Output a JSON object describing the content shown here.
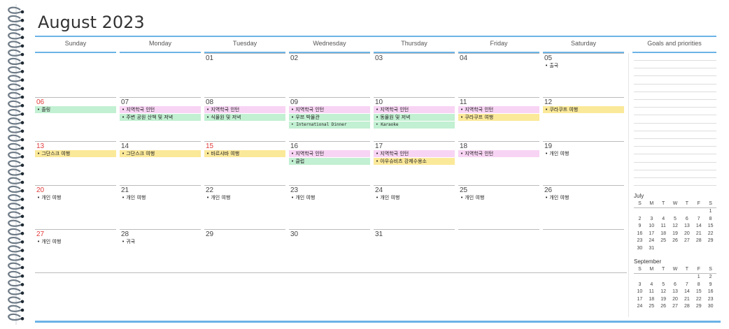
{
  "title": "August 2023",
  "goals_title": "Goals and priorities",
  "colors": {
    "accent": "#6bb3e6",
    "pink": "#f8d4f4",
    "green": "#c2f0d2",
    "yellow": "#fbe99a",
    "weekend_red": "#e23b3b"
  },
  "weekdays": [
    "Sunday",
    "Monday",
    "Tuesday",
    "Wednesday",
    "Thursday",
    "Friday",
    "Saturday"
  ],
  "weeks": [
    [
      {
        "num": "",
        "events": []
      },
      {
        "num": "",
        "events": []
      },
      {
        "num": "01",
        "events": []
      },
      {
        "num": "02",
        "events": []
      },
      {
        "num": "03",
        "events": []
      },
      {
        "num": "04",
        "events": []
      },
      {
        "num": "05",
        "events": [
          {
            "text": "• 출국",
            "color": "none"
          }
        ]
      }
    ],
    [
      {
        "num": "06",
        "red": true,
        "events": [
          {
            "text": "• 졸링",
            "color": "green"
          }
        ]
      },
      {
        "num": "07",
        "events": [
          {
            "text": "• 지역학국 인턴",
            "color": "pink"
          },
          {
            "text": "• 주변 공원 산책 및 저녁",
            "color": "green"
          }
        ]
      },
      {
        "num": "08",
        "events": [
          {
            "text": "• 지역학국 인턴",
            "color": "pink"
          },
          {
            "text": "• 식물원 및 저녁",
            "color": "green"
          }
        ]
      },
      {
        "num": "09",
        "events": [
          {
            "text": "• 지역학국 인턴",
            "color": "pink"
          },
          {
            "text": "• 우쯔 박물관",
            "color": "green"
          },
          {
            "text": "• International Dinner",
            "color": "green",
            "mono": true
          }
        ]
      },
      {
        "num": "10",
        "events": [
          {
            "text": "• 지역학국 인턴",
            "color": "pink"
          },
          {
            "text": "• 동물원 및 저녁",
            "color": "green"
          },
          {
            "text": "• Karaoke",
            "color": "green",
            "mono": true
          }
        ]
      },
      {
        "num": "11",
        "events": [
          {
            "text": "• 지역학국 인턴",
            "color": "pink"
          },
          {
            "text": "• 쿠라쿠프 여행",
            "color": "yellow"
          }
        ]
      },
      {
        "num": "12",
        "events": [
          {
            "text": "• 쿠라쿠프 여행",
            "color": "yellow"
          }
        ]
      }
    ],
    [
      {
        "num": "13",
        "red": true,
        "events": [
          {
            "text": "• 그단스크 여행",
            "color": "yellow"
          }
        ]
      },
      {
        "num": "14",
        "events": [
          {
            "text": "• 그단스크 여행",
            "color": "yellow"
          }
        ]
      },
      {
        "num": "15",
        "red": true,
        "events": [
          {
            "text": "• 바르샤바 여행",
            "color": "yellow"
          }
        ]
      },
      {
        "num": "16",
        "events": [
          {
            "text": "• 지역학국 인턴",
            "color": "pink"
          },
          {
            "text": "• 클럽",
            "color": "green"
          }
        ]
      },
      {
        "num": "17",
        "events": [
          {
            "text": "• 지역학국 인턴",
            "color": "pink"
          },
          {
            "text": "• 아우슈비츠 강제수용소",
            "color": "yellow"
          }
        ]
      },
      {
        "num": "18",
        "events": [
          {
            "text": "• 지역학국 인턴",
            "color": "pink"
          }
        ]
      },
      {
        "num": "19",
        "events": [
          {
            "text": "• 개인 여행",
            "color": "none"
          }
        ]
      }
    ],
    [
      {
        "num": "20",
        "red": true,
        "events": [
          {
            "text": "• 개인 여행",
            "color": "none"
          }
        ]
      },
      {
        "num": "21",
        "events": [
          {
            "text": "• 개인 여행",
            "color": "none"
          }
        ]
      },
      {
        "num": "22",
        "events": [
          {
            "text": "• 개인 여행",
            "color": "none"
          }
        ]
      },
      {
        "num": "23",
        "events": [
          {
            "text": "• 개인 여행",
            "color": "none"
          }
        ]
      },
      {
        "num": "24",
        "events": [
          {
            "text": "• 개인 여행",
            "color": "none"
          }
        ]
      },
      {
        "num": "25",
        "events": [
          {
            "text": "• 개인 여행",
            "color": "none"
          }
        ]
      },
      {
        "num": "26",
        "events": [
          {
            "text": "• 개인 여행",
            "color": "none"
          }
        ]
      }
    ],
    [
      {
        "num": "27",
        "red": true,
        "events": [
          {
            "text": "• 개인 여행",
            "color": "none"
          }
        ]
      },
      {
        "num": "28",
        "events": [
          {
            "text": "• 귀국",
            "color": "none"
          }
        ]
      },
      {
        "num": "29",
        "events": []
      },
      {
        "num": "30",
        "events": []
      },
      {
        "num": "31",
        "events": []
      },
      {
        "num": "",
        "events": []
      },
      {
        "num": "",
        "events": []
      }
    ]
  ],
  "mini_calendars": [
    {
      "title": "July",
      "headers": [
        "S",
        "M",
        "T",
        "W",
        "T",
        "F",
        "S"
      ],
      "rows": [
        [
          "",
          "",
          "",
          "",
          "",
          "",
          "1"
        ],
        [
          "2",
          "3",
          "4",
          "5",
          "6",
          "7",
          "8"
        ],
        [
          "9",
          "10",
          "11",
          "12",
          "13",
          "14",
          "15"
        ],
        [
          "16",
          "17",
          "18",
          "19",
          "20",
          "21",
          "22"
        ],
        [
          "23",
          "24",
          "25",
          "26",
          "27",
          "28",
          "29"
        ],
        [
          "30",
          "31",
          "",
          "",
          "",
          "",
          ""
        ]
      ]
    },
    {
      "title": "September",
      "headers": [
        "S",
        "M",
        "T",
        "W",
        "T",
        "F",
        "S"
      ],
      "rows": [
        [
          "",
          "",
          "",
          "",
          "",
          "1",
          "2"
        ],
        [
          "3",
          "4",
          "5",
          "6",
          "7",
          "8",
          "9"
        ],
        [
          "10",
          "11",
          "12",
          "13",
          "14",
          "15",
          "16"
        ],
        [
          "17",
          "18",
          "19",
          "20",
          "21",
          "22",
          "23"
        ],
        [
          "24",
          "25",
          "26",
          "27",
          "28",
          "29",
          "30"
        ]
      ]
    }
  ]
}
